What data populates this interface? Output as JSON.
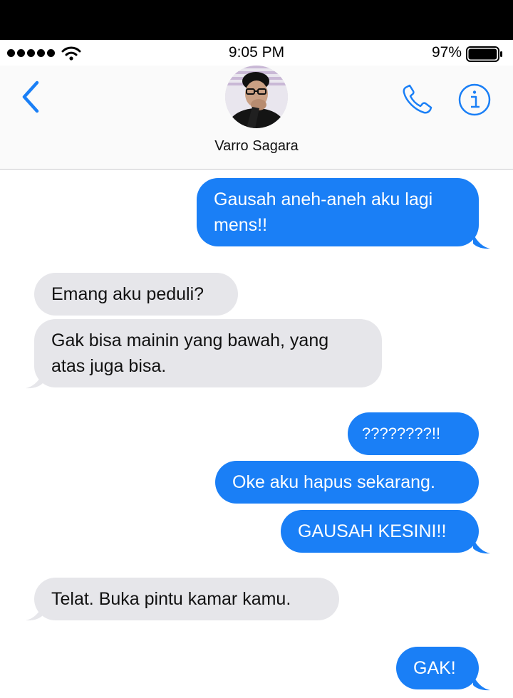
{
  "status_bar": {
    "time": "9:05 PM",
    "battery_percent": "97%",
    "signal_icon": "signal-dots-icon",
    "wifi_icon": "wifi-icon",
    "battery_icon": "battery-icon",
    "battery_level": 0.97
  },
  "header": {
    "contact_name": "Varro Sagara",
    "back_icon": "chevron-left-icon",
    "call_icon": "phone-icon",
    "info_icon": "info-icon"
  },
  "colors": {
    "accent": "#1a7ff6",
    "outgoing_bubble": "#1a7ff6",
    "incoming_bubble": "#e6e6ea"
  },
  "messages": [
    {
      "direction": "out",
      "text": "Gausah aneh-aneh aku lagi mens!!"
    },
    {
      "direction": "in",
      "text": "Emang aku peduli?"
    },
    {
      "direction": "in",
      "text": "Gak bisa mainin yang bawah, yang atas juga bisa."
    },
    {
      "direction": "out",
      "text": "????????!!"
    },
    {
      "direction": "out",
      "text": "Oke aku hapus sekarang."
    },
    {
      "direction": "out",
      "text": "GAUSAH KESINI!!"
    },
    {
      "direction": "in",
      "text": "Telat. Buka pintu kamar kamu."
    },
    {
      "direction": "out",
      "text": "GAK!"
    }
  ]
}
